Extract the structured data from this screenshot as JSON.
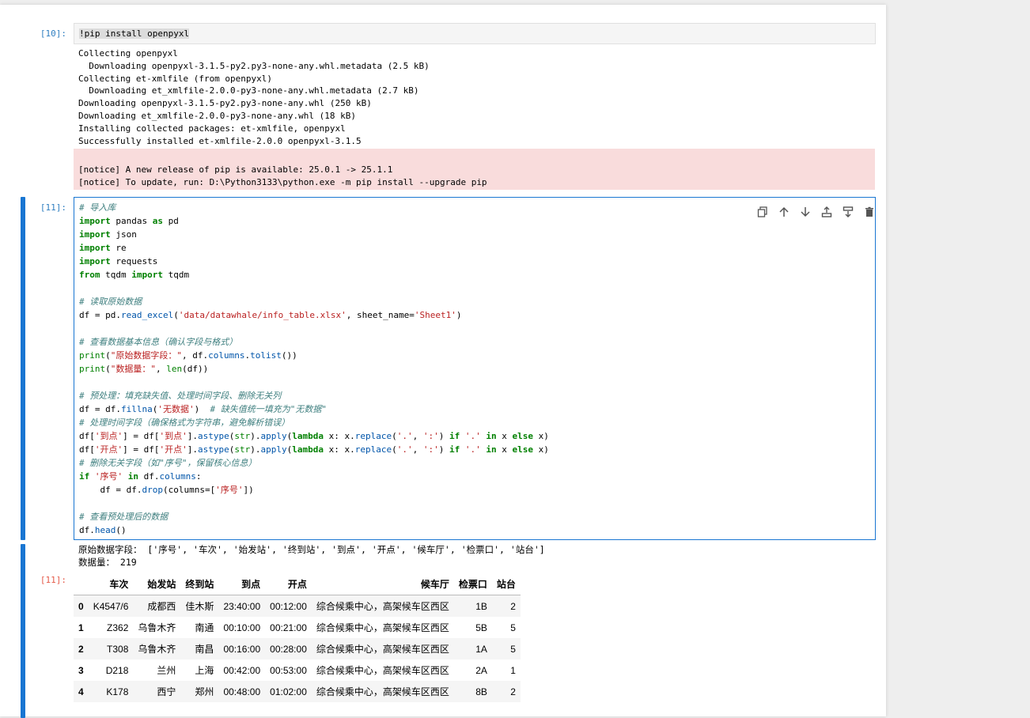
{
  "cells": {
    "c10": {
      "prompt": "[10]:",
      "code": "!pip install openpyxl",
      "stdout": [
        "Collecting openpyxl",
        "  Downloading openpyxl-3.1.5-py2.py3-none-any.whl.metadata (2.5 kB)",
        "Collecting et-xmlfile (from openpyxl)",
        "  Downloading et_xmlfile-2.0.0-py3-none-any.whl.metadata (2.7 kB)",
        "Downloading openpyxl-3.1.5-py2.py3-none-any.whl (250 kB)",
        "Downloading et_xmlfile-2.0.0-py3-none-any.whl (18 kB)",
        "Installing collected packages: et-xmlfile, openpyxl",
        "Successfully installed et-xmlfile-2.0.0 openpyxl-3.1.5"
      ],
      "stderr": [
        "[notice] A new release of pip is available: 25.0.1 -> 25.1.1",
        "[notice] To update, run: D:\\Python3133\\python.exe -m pip install --upgrade pip"
      ]
    },
    "c11": {
      "prompt": "[11]:",
      "output_prompt": "[11]:",
      "print1": "原始数据字段： ['序号', '车次', '始发站', '终到站', '到点', '开点', '候车厅', '检票口', '站台']",
      "print2": "数据量： 219"
    }
  },
  "toolbar": {
    "icons": [
      "duplicate-icon",
      "move-up-icon",
      "move-down-icon",
      "insert-above-icon",
      "insert-below-icon",
      "delete-icon"
    ]
  },
  "dataframe": {
    "columns": [
      "",
      "车次",
      "始发站",
      "终到站",
      "到点",
      "开点",
      "候车厅",
      "检票口",
      "站台"
    ],
    "rows": [
      [
        "0",
        "K4547/6",
        "成都西",
        "佳木斯",
        "23:40:00",
        "00:12:00",
        "综合候乘中心，高架候车区西区",
        "1B",
        "2"
      ],
      [
        "1",
        "Z362",
        "乌鲁木齐",
        "南通",
        "00:10:00",
        "00:21:00",
        "综合候乘中心，高架候车区西区",
        "5B",
        "5"
      ],
      [
        "2",
        "T308",
        "乌鲁木齐",
        "南昌",
        "00:16:00",
        "00:28:00",
        "综合候乘中心，高架候车区西区",
        "1A",
        "5"
      ],
      [
        "3",
        "D218",
        "兰州",
        "上海",
        "00:42:00",
        "00:53:00",
        "综合候乘中心，高架候车区西区",
        "2A",
        "1"
      ],
      [
        "4",
        "K178",
        "西宁",
        "郑州",
        "00:48:00",
        "01:02:00",
        "综合候乘中心，高架候车区西区",
        "8B",
        "2"
      ]
    ]
  },
  "colors": {
    "accent": "#1976d2",
    "prompt": "#307fc1",
    "stderr_bg": "#f9dcdc"
  }
}
